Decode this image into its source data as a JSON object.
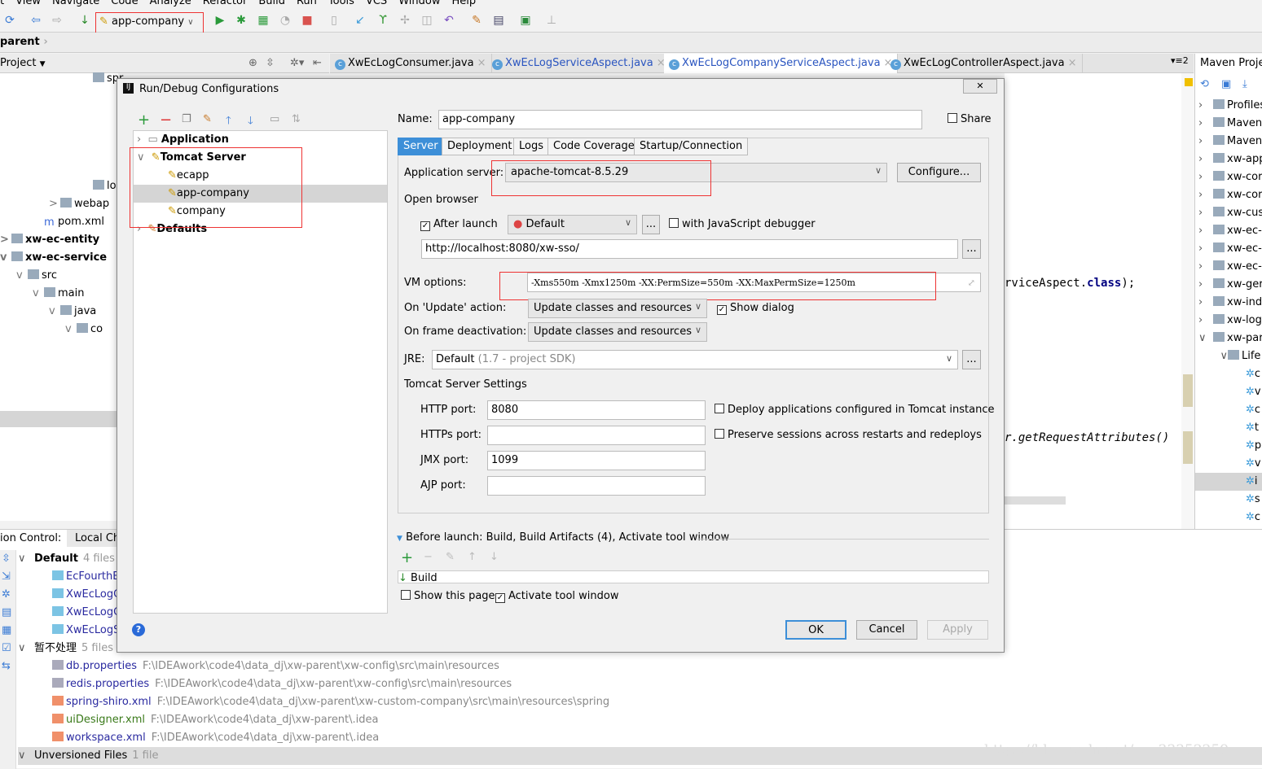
{
  "menu": [
    "t",
    "View",
    "Navigate",
    "Code",
    "Analyze",
    "Refactor",
    "Build",
    "Run",
    "Tools",
    "VCS",
    "Window",
    "Help"
  ],
  "toolbar": {
    "run_config": "app-company"
  },
  "breadcrumb": "parent",
  "project_panel": {
    "title": "Project",
    "tree": [
      {
        "label": "spr",
        "indent": 110
      },
      {
        "label": "log",
        "indent": 110
      },
      {
        "label": "webap",
        "indent": 70,
        "arrow": ">"
      },
      {
        "label": "pom.xml",
        "indent": 50
      },
      {
        "label": "xw-ec-entity",
        "indent": 10,
        "arrow": ">",
        "bold": true
      },
      {
        "label": "xw-ec-service",
        "indent": 10,
        "arrow": "v",
        "bold": true
      },
      {
        "label": "src",
        "indent": 30,
        "arrow": "v"
      },
      {
        "label": "main",
        "indent": 50,
        "arrow": "v"
      },
      {
        "label": "java",
        "indent": 70,
        "arrow": "v"
      },
      {
        "label": "co",
        "indent": 90,
        "arrow": "v"
      }
    ]
  },
  "editor_tabs": [
    {
      "label": "XwEcLogConsumer.java",
      "active": false
    },
    {
      "label": "XwEcLogServiceAspect.java",
      "active": false,
      "color": "#2a55c0"
    },
    {
      "label": "XwEcLogCompanyServiceAspect.java",
      "active": true,
      "color": "#2a55c0"
    },
    {
      "label": "XwEcLogControllerAspect.java",
      "active": false
    }
  ],
  "editor_tab_count": "2",
  "editor": {
    "line1": "rviceAspect.",
    "line1_kw": "class",
    "line1_end": ");",
    "line2": "r.getRequestAttributes()"
  },
  "maven": {
    "title": "Maven Projects",
    "items": [
      "Profiles",
      "Maven",
      "Maven",
      "xw-app",
      "xw-cor",
      "xw-cor",
      "xw-cus",
      "xw-ec-",
      "xw-ec-",
      "xw-ec-",
      "xw-ger",
      "xw-ind",
      "xw-log",
      "xw-par",
      "Life"
    ],
    "lifecycle": [
      "c",
      "v",
      "c",
      "t",
      "p",
      "v",
      "i",
      "s",
      "c"
    ]
  },
  "vcs": {
    "tab_label": "ion Control:",
    "tab_local": "Local Ch",
    "groups": [
      {
        "name": "Default",
        "count": "4 files",
        "files": [
          {
            "name": "EcFourthB",
            "path": ""
          },
          {
            "name": "XwEcLogC",
            "path": ""
          },
          {
            "name": "XwEcLogC",
            "path": ""
          },
          {
            "name": "XwEcLogS",
            "path": ""
          }
        ]
      },
      {
        "name": "暂不处理",
        "count": "5 files",
        "files": [
          {
            "name": "db.properties",
            "path": "F:\\IDEAwork\\code4\\data_dj\\xw-parent\\xw-config\\src\\main\\resources"
          },
          {
            "name": "redis.properties",
            "path": "F:\\IDEAwork\\code4\\data_dj\\xw-parent\\xw-config\\src\\main\\resources"
          },
          {
            "name": "spring-shiro.xml",
            "path": "F:\\IDEAwork\\code4\\data_dj\\xw-parent\\xw-custom-company\\src\\main\\resources\\spring"
          },
          {
            "name": "uiDesigner.xml",
            "path": "F:\\IDEAwork\\code4\\data_dj\\xw-parent\\.idea"
          },
          {
            "name": "workspace.xml",
            "path": "F:\\IDEAwork\\code4\\data_dj\\xw-parent\\.idea"
          }
        ]
      },
      {
        "name": "Unversioned Files",
        "count": "1 file",
        "files": []
      }
    ]
  },
  "watermark": "https://blog.csdn.net/qq_33352259",
  "dialog": {
    "title": "Run/Debug Configurations",
    "tree": {
      "application": "Application",
      "tomcat": "Tomcat Server",
      "children": [
        "ecapp",
        "app-company",
        "company"
      ],
      "selected": 1,
      "defaults": "Defaults"
    },
    "name_label": "Name:",
    "name_value": "app-company",
    "share_label": "Share",
    "share_checked": false,
    "tabs": [
      "Server",
      "Deployment",
      "Logs",
      "Code Coverage",
      "Startup/Connection"
    ],
    "active_tab": 0,
    "app_server_label": "Application server:",
    "app_server_value": "apache-tomcat-8.5.29",
    "configure_label": "Configure...",
    "open_browser_label": "Open browser",
    "after_launch_label": "After launch",
    "after_launch_checked": true,
    "browser_value": "Default",
    "browse_btn": "...",
    "js_debugger_label": "with JavaScript debugger",
    "js_debugger_checked": false,
    "url_value": "http://localhost:8080/xw-sso/",
    "vm_label": "VM options:",
    "vm_value": "-Xms550m  -Xmx1250m  -XX:PermSize=550m -XX:MaxPermSize=1250m",
    "update_label": "On 'Update' action:",
    "update_value": "Update classes and resources",
    "show_dialog_label": "Show dialog",
    "show_dialog_checked": true,
    "frame_label": "On frame deactivation:",
    "frame_value": "Update classes and resources",
    "jre_label": "JRE:",
    "jre_value": "Default",
    "jre_hint": "(1.7 - project SDK)",
    "tomcat_settings_label": "Tomcat Server Settings",
    "http_label": "HTTP port:",
    "http_value": "8080",
    "https_label": "HTTPs port:",
    "https_value": "",
    "jmx_label": "JMX port:",
    "jmx_value": "1099",
    "ajp_label": "AJP port:",
    "ajp_value": "",
    "deploy_label": "Deploy applications configured in Tomcat instance",
    "deploy_checked": false,
    "preserve_label": "Preserve sessions across restarts and redeploys",
    "preserve_checked": false,
    "before_launch_label": "Before launch: Build, Build Artifacts (4), Activate tool window",
    "before_launch_items": [
      "Build"
    ],
    "show_page_label": "Show this page",
    "show_page_checked": false,
    "activate_label": "Activate tool window",
    "activate_checked": true,
    "ok": "OK",
    "cancel": "Cancel",
    "apply": "Apply",
    "help": "?"
  }
}
